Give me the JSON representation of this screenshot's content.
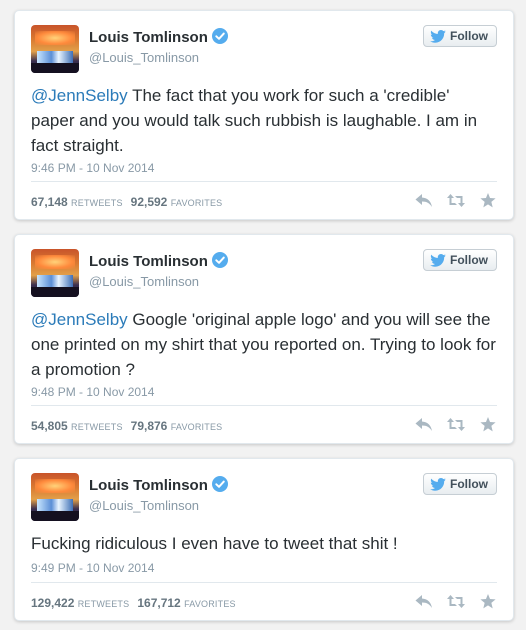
{
  "tweets": [
    {
      "name": "Louis Tomlinson",
      "handle": "@Louis_Tomlinson",
      "follow_label": "Follow",
      "mention": "@JennSelby",
      "text": " The fact that you work for such a 'credible' paper and you would talk such rubbish is laughable. I am in fact straight.",
      "time": "9:46 PM - 10 Nov 2014",
      "retweets": "67,148",
      "retweets_label": "RETWEETS",
      "favorites": "92,592",
      "favorites_label": "FAVORITES"
    },
    {
      "name": "Louis Tomlinson",
      "handle": "@Louis_Tomlinson",
      "follow_label": "Follow",
      "mention": "@JennSelby",
      "text": " Google 'original apple logo' and you will see the one printed on my shirt that you reported on. Trying to look for a promotion ?",
      "time": "9:48 PM - 10 Nov 2014",
      "retweets": "54,805",
      "retweets_label": "RETWEETS",
      "favorites": "79,876",
      "favorites_label": "FAVORITES"
    },
    {
      "name": "Louis Tomlinson",
      "handle": "@Louis_Tomlinson",
      "follow_label": "Follow",
      "mention": "",
      "text": "Fucking ridiculous I even have to tweet that shit !",
      "time": "9:49 PM - 10 Nov 2014",
      "retweets": "129,422",
      "retweets_label": "RETWEETS",
      "favorites": "167,712",
      "favorites_label": "FAVORITES"
    }
  ],
  "icons": {
    "verified": "verified-badge-icon",
    "follow": "twitter-bird-icon",
    "reply": "reply-icon",
    "retweet": "retweet-icon",
    "favorite": "star-icon"
  },
  "colors": {
    "link": "#2b7bb9",
    "verified": "#55acee",
    "muted": "#8899a6"
  }
}
